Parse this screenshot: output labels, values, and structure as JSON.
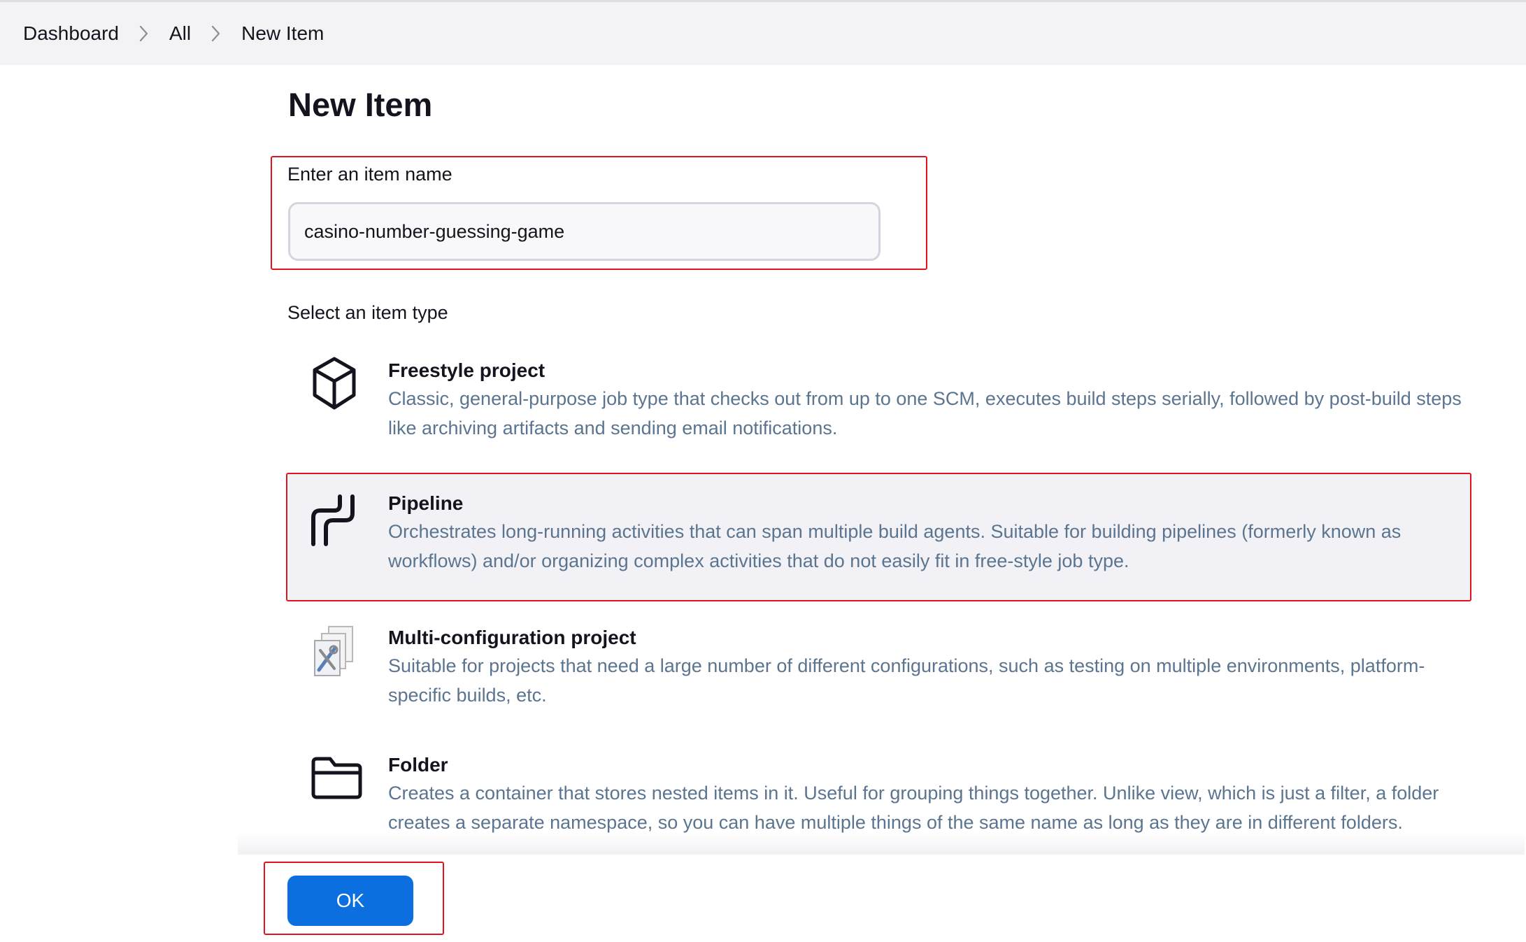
{
  "breadcrumb": [
    "Dashboard",
    "All",
    "New Item"
  ],
  "page": {
    "title": "New Item"
  },
  "name_field": {
    "label": "Enter an item name",
    "value": "casino-number-guessing-game"
  },
  "item_type_label": "Select an item type",
  "item_types": [
    {
      "icon": "cube-icon",
      "title": "Freestyle project",
      "description": "Classic, general-purpose job type that checks out from up to one SCM, executes build steps serially, followed by post-build steps like archiving artifacts and sending email notifications."
    },
    {
      "icon": "pipeline-icon",
      "title": "Pipeline",
      "description": "Orchestrates long-running activities that can span multiple build agents. Suitable for building pipelines (formerly known as workflows) and/or organizing complex activities that do not easily fit in free-style job type."
    },
    {
      "icon": "multi-config-icon",
      "title": "Multi-configuration project",
      "description": "Suitable for projects that need a large number of different configurations, such as testing on multiple environments, platform-specific builds, etc."
    },
    {
      "icon": "folder-icon",
      "title": "Folder",
      "description": "Creates a container that stores nested items in it. Useful for grouping things together. Unlike view, which is just a filter, a folder creates a separate namespace, so you can have multiple things of the same name as long as they are in different folders."
    }
  ],
  "ok_button": {
    "label": "OK"
  },
  "colors": {
    "accent": "#0b6fe0",
    "highlight": "#e0141e",
    "description_text": "#5b7590",
    "selected_bg": "#f2f2f6"
  }
}
